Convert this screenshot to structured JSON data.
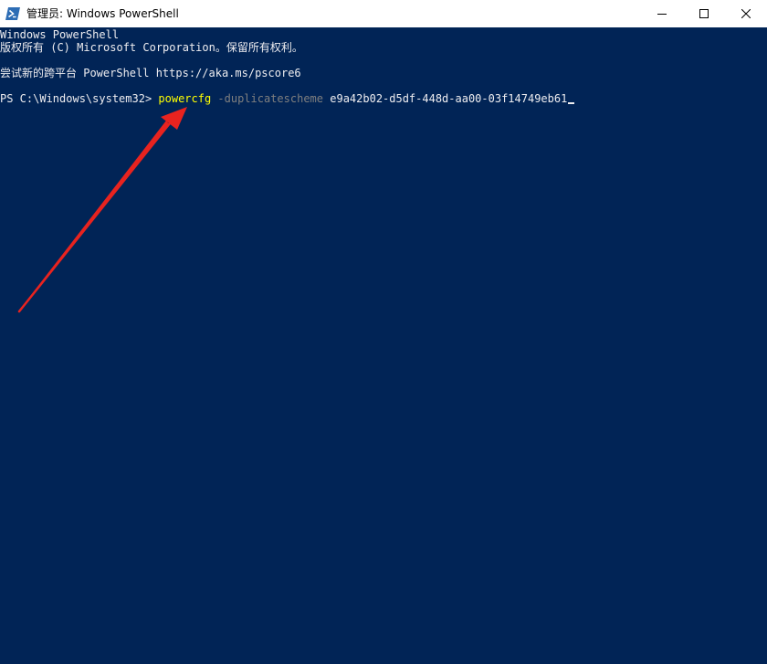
{
  "window": {
    "title": "管理员: Windows PowerShell",
    "icon": "powershell-icon",
    "controls": [
      "minimize-icon",
      "maximize-icon",
      "close-icon"
    ]
  },
  "console": {
    "banner_line1": "Windows PowerShell",
    "banner_line2": "版权所有 (C) Microsoft Corporation。保留所有权利。",
    "banner_line3": "尝试新的跨平台 PowerShell https://aka.ms/pscore6",
    "prompt": "PS C:\\Windows\\system32> ",
    "command": "powercfg",
    "parameter": " -duplicatescheme",
    "argument": " e9a42b02-d5df-448d-aa00-03f14749eb61"
  },
  "colors": {
    "console_background": "#012456",
    "console_text": "#eeedf0",
    "command_text": "#ffff00",
    "parameter_text": "#7f7f7f",
    "annotation_arrow": "#e8231f"
  }
}
